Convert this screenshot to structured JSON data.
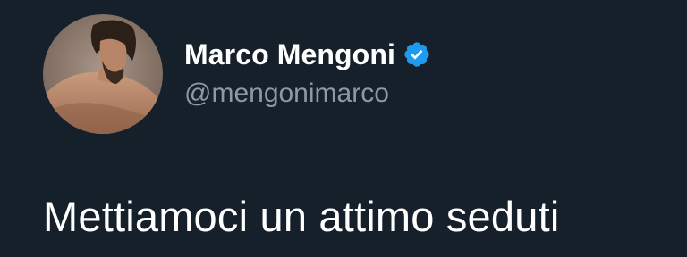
{
  "tweet": {
    "author": {
      "display_name": "Marco Mengoni",
      "handle": "@mengonimarco",
      "verified": true,
      "verified_icon": "verified-badge-icon",
      "avatar": "profile-photo"
    },
    "text": "Mettiamoci un attimo seduti"
  },
  "colors": {
    "background": "#15202b",
    "name": "#ffffff",
    "handle": "#8b98a5",
    "verified_badge": "#1d9bf0"
  }
}
